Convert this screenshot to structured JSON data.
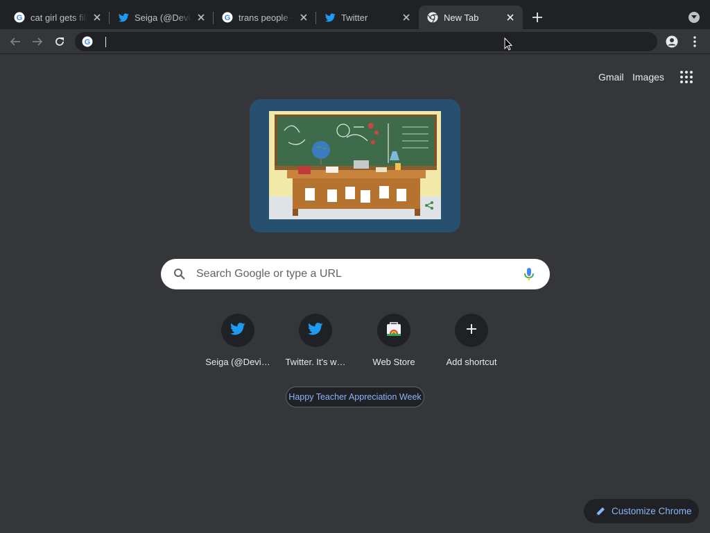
{
  "tabs": [
    {
      "title": "cat girl gets fill",
      "icon": "google-g-icon",
      "active": false
    },
    {
      "title": "Seiga (@Devia",
      "icon": "twitter-bird-icon",
      "active": false
    },
    {
      "title": "trans people -",
      "icon": "google-g-icon",
      "active": false
    },
    {
      "title": "Twitter",
      "icon": "twitter-bird-icon",
      "active": false
    },
    {
      "title": "New Tab",
      "icon": "chrome-icon",
      "active": true
    }
  ],
  "omnibox": {
    "value": "",
    "placeholder": ""
  },
  "header_links": {
    "gmail": "Gmail",
    "images": "Images"
  },
  "search": {
    "placeholder": "Search Google or type a URL"
  },
  "shortcuts": [
    {
      "label": "Seiga (@Devi…",
      "icon": "twitter-bird-icon"
    },
    {
      "label": "Twitter. It's w…",
      "icon": "twitter-bird-icon"
    },
    {
      "label": "Web Store",
      "icon": "web-store-icon"
    },
    {
      "label": "Add shortcut",
      "icon": "plus-icon"
    }
  ],
  "promo": {
    "label": "Happy Teacher Appreciation Week"
  },
  "customize": {
    "label": "Customize Chrome"
  },
  "colors": {
    "tabstrip": "#202124",
    "toolbar": "#35363a",
    "text": "#e8eaed",
    "accent": "#8ab4f8",
    "twitter": "#1d9bf0"
  }
}
